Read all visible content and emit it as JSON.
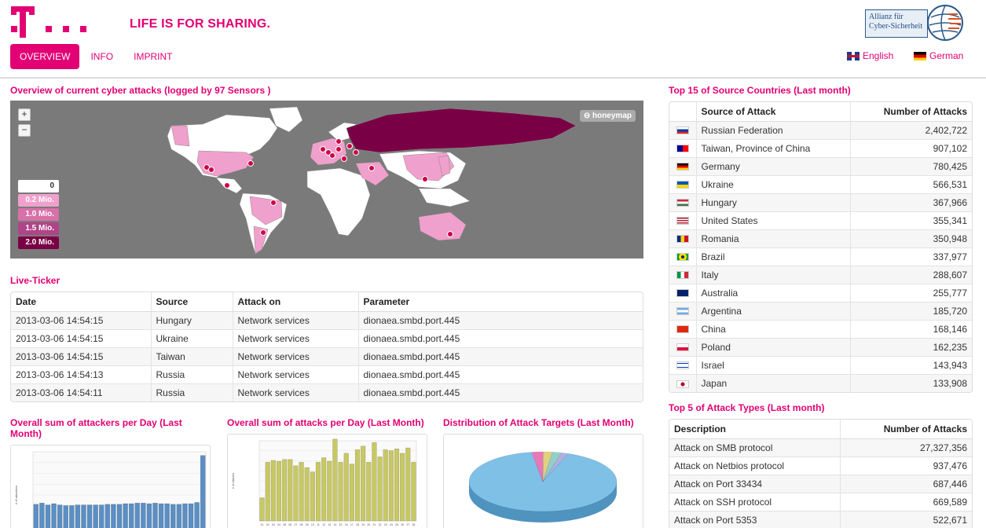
{
  "header": {
    "tagline": "LIFE IS FOR SHARING.",
    "nav": [
      {
        "label": "OVERVIEW",
        "active": true
      },
      {
        "label": "INFO",
        "active": false
      },
      {
        "label": "IMPRINT",
        "active": false
      }
    ],
    "partner_logo_text": "Allianz für Cyber-Sicherheit",
    "languages": [
      {
        "label": "English",
        "flag": "uk-flag-icon"
      },
      {
        "label": "German",
        "flag": "de-flag-icon"
      }
    ],
    "brand_color": "#e20074"
  },
  "map_section": {
    "title": "Overview of current cyber attacks (logged by 97 Sensors )",
    "zoom_in": "+",
    "zoom_out": "−",
    "badge": "honeymap",
    "legend": [
      {
        "label": "0",
        "color": "#ffffff",
        "text": "#333333"
      },
      {
        "label": "0.2 Mio.",
        "color": "#f0a0cc",
        "text": "#ffffff"
      },
      {
        "label": "1.0 Mio.",
        "color": "#d870aa",
        "text": "#ffffff"
      },
      {
        "label": "1.5 Mio.",
        "color": "#b04488",
        "text": "#ffffff"
      },
      {
        "label": "2.0 Mio.",
        "color": "#7a0045",
        "text": "#ffffff"
      }
    ]
  },
  "live_ticker": {
    "title": "Live-Ticker",
    "columns": [
      "Date",
      "Source",
      "Attack on",
      "Parameter"
    ],
    "rows": [
      [
        "2013-03-06 14:54:15",
        "Hungary",
        "Network services",
        "dionaea.smbd.port.445"
      ],
      [
        "2013-03-06 14:54:15",
        "Ukraine",
        "Network services",
        "dionaea.smbd.port.445"
      ],
      [
        "2013-03-06 14:54:15",
        "Taiwan",
        "Network services",
        "dionaea.smbd.port.445"
      ],
      [
        "2013-03-06 14:54:13",
        "Russia",
        "Network services",
        "dionaea.smbd.port.445"
      ],
      [
        "2013-03-06 14:54:11",
        "Russia",
        "Network services",
        "dionaea.smbd.port.445"
      ]
    ]
  },
  "charts": {
    "attackers_title": "Overall sum of attackers per Day (Last Month)",
    "attacks_title": "Overall sum of attacks per Day (Last Month)",
    "targets_title": "Distribution of Attack Targets (Last Month)"
  },
  "chart_data": [
    {
      "type": "bar",
      "ylabel": "# of attackers",
      "values": [
        5500,
        5700,
        5400,
        5600,
        5400,
        5300,
        5300,
        5400,
        5400,
        5400,
        5400,
        5400,
        5500,
        5500,
        5500,
        5600,
        5600,
        5700,
        5700,
        5600,
        5700,
        5600,
        5600,
        5500,
        5500,
        5600,
        5600,
        5800,
        13400
      ],
      "ylim": [
        0,
        14000
      ],
      "color": "#5b8fc4"
    },
    {
      "type": "bar",
      "ylabel": "# of attacks",
      "categories": [
        "01",
        "02",
        "03",
        "04",
        "05",
        "06",
        "07",
        "08",
        "09",
        "10",
        "11",
        "12",
        "13",
        "14",
        "15",
        "16",
        "17",
        "18",
        "19",
        "20",
        "21",
        "22",
        "23",
        "24",
        "25",
        "26",
        "27",
        "28"
      ],
      "values": [
        130000,
        330000,
        340000,
        335000,
        345000,
        345000,
        310000,
        330000,
        300000,
        275000,
        330000,
        355000,
        335000,
        460000,
        330000,
        380000,
        320000,
        400000,
        420000,
        330000,
        440000,
        360000,
        400000,
        395000,
        405000,
        380000,
        410000,
        330000
      ],
      "ylim": [
        0,
        450000
      ],
      "color": "#c8c864"
    },
    {
      "type": "pie",
      "slices": [
        {
          "value": 92,
          "color": "#7ec0e6"
        },
        {
          "value": 2.5,
          "color": "#e878b8"
        },
        {
          "value": 2,
          "color": "#e0d080"
        },
        {
          "value": 2,
          "color": "#90d0c8"
        },
        {
          "value": 1.5,
          "color": "#b0b0e0"
        }
      ]
    }
  ],
  "top_countries": {
    "title": "Top 15 of Source Countries (Last month)",
    "columns": [
      "Source of Attack",
      "Number of Attacks"
    ],
    "rows": [
      {
        "country": "Russian Federation",
        "count": "2,402,722",
        "flag": "ru-flag-icon"
      },
      {
        "country": "Taiwan, Province of China",
        "count": "907,102",
        "flag": "tw-flag-icon"
      },
      {
        "country": "Germany",
        "count": "780,425",
        "flag": "de-flag-icon"
      },
      {
        "country": "Ukraine",
        "count": "566,531",
        "flag": "ua-flag-icon"
      },
      {
        "country": "Hungary",
        "count": "367,966",
        "flag": "hu-flag-icon"
      },
      {
        "country": "United States",
        "count": "355,341",
        "flag": "us-flag-icon"
      },
      {
        "country": "Romania",
        "count": "350,948",
        "flag": "ro-flag-icon"
      },
      {
        "country": "Brazil",
        "count": "337,977",
        "flag": "br-flag-icon"
      },
      {
        "country": "Italy",
        "count": "288,607",
        "flag": "it-flag-icon"
      },
      {
        "country": "Australia",
        "count": "255,777",
        "flag": "au-flag-icon"
      },
      {
        "country": "Argentina",
        "count": "185,720",
        "flag": "ar-flag-icon"
      },
      {
        "country": "China",
        "count": "168,146",
        "flag": "cn-flag-icon"
      },
      {
        "country": "Poland",
        "count": "162,235",
        "flag": "pl-flag-icon"
      },
      {
        "country": "Israel",
        "count": "143,943",
        "flag": "il-flag-icon"
      },
      {
        "country": "Japan",
        "count": "133,908",
        "flag": "jp-flag-icon"
      }
    ]
  },
  "attack_types": {
    "title": "Top 5 of Attack Types (Last month)",
    "columns": [
      "Description",
      "Number of Attacks"
    ],
    "rows": [
      {
        "desc": "Attack on SMB protocol",
        "count": "27,327,356"
      },
      {
        "desc": "Attack on Netbios protocol",
        "count": "937,476"
      },
      {
        "desc": "Attack on Port 33434",
        "count": "687,446"
      },
      {
        "desc": "Attack on SSH protocol",
        "count": "669,589"
      },
      {
        "desc": "Attack on Port 5353",
        "count": "522,671"
      }
    ]
  }
}
